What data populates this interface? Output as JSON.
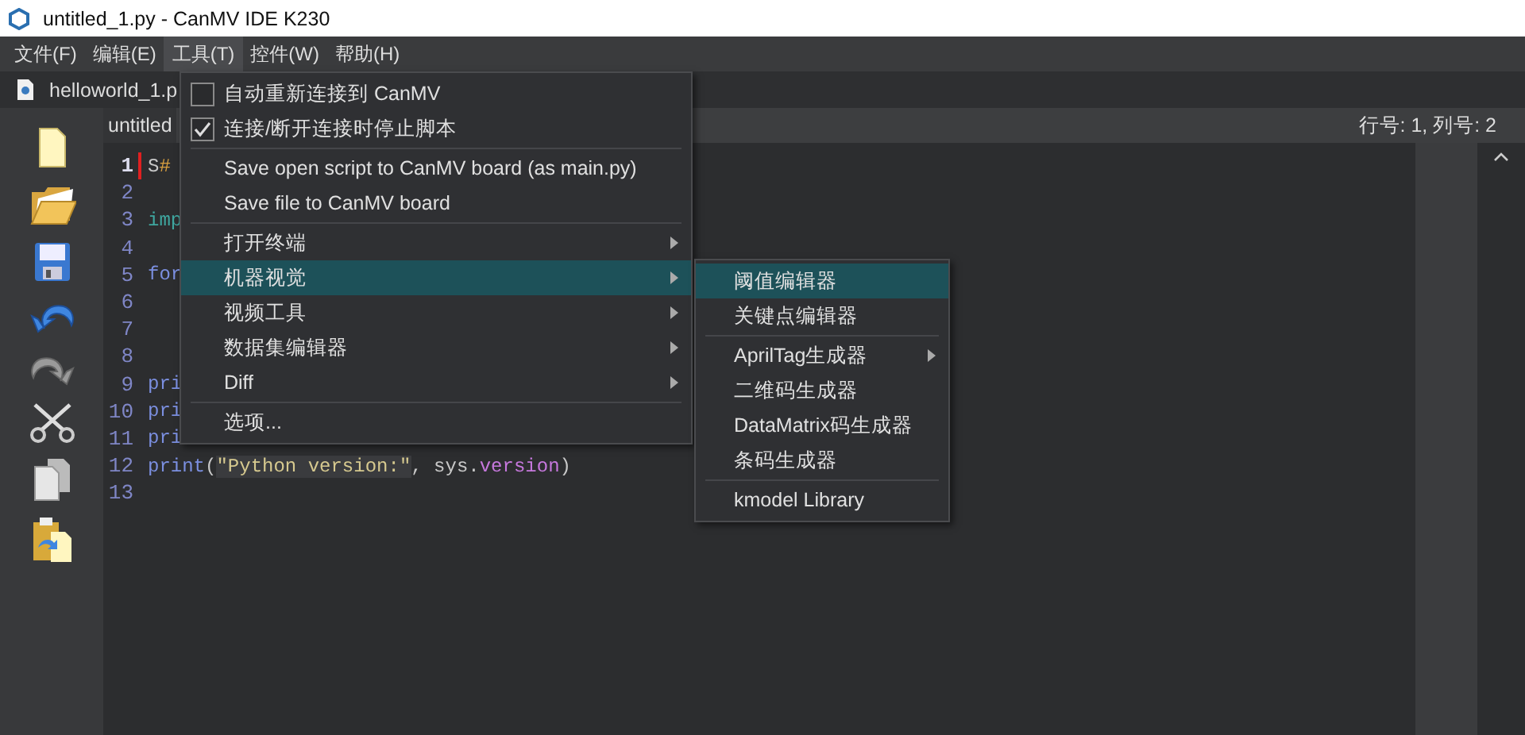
{
  "window": {
    "title": "untitled_1.py - CanMV IDE K230"
  },
  "menubar": [
    {
      "label": "文件(F)",
      "selected": false
    },
    {
      "label": "编辑(E)",
      "selected": false
    },
    {
      "label": "工具(T)",
      "selected": true
    },
    {
      "label": "控件(W)",
      "selected": false
    },
    {
      "label": "帮助(H)",
      "selected": false
    }
  ],
  "file_tabs": [
    {
      "label": "helloworld_1.p"
    }
  ],
  "toolbar": [
    {
      "kind": "new"
    },
    {
      "kind": "open"
    },
    {
      "kind": "save"
    },
    {
      "kind": "undo"
    },
    {
      "kind": "redo"
    },
    {
      "kind": "cut"
    },
    {
      "kind": "copy"
    },
    {
      "kind": "paste"
    }
  ],
  "editor": {
    "tab": "untitled",
    "status": "行号: 1, 列号: 2",
    "lines": [
      {
        "number": "1",
        "current": true,
        "tokens": [
          {
            "kind": "text",
            "text": "S"
          },
          {
            "kind": "comment",
            "text": "#"
          }
        ]
      },
      {
        "number": "2",
        "current": false
      },
      {
        "number": "3",
        "current": false,
        "tokens": [
          {
            "kind": "module",
            "text": "imp"
          }
        ]
      },
      {
        "number": "4",
        "current": false
      },
      {
        "number": "5",
        "current": false,
        "tokens": [
          {
            "kind": "keyword",
            "text": "for"
          }
        ]
      },
      {
        "number": "6",
        "current": false
      },
      {
        "number": "7",
        "current": false
      },
      {
        "number": "8",
        "current": false
      },
      {
        "number": "9",
        "current": false,
        "tokens": [
          {
            "kind": "keyword",
            "text": "pri"
          }
        ]
      },
      {
        "number": "10",
        "current": false,
        "tokens": [
          {
            "kind": "keyword",
            "text": "pri"
          }
        ]
      },
      {
        "number": "11",
        "current": false,
        "tokens": [
          {
            "kind": "keyword",
            "text": "pri"
          }
        ]
      },
      {
        "number": "12",
        "current": false,
        "tokens": [
          {
            "kind": "keyword",
            "text": "print"
          },
          {
            "kind": "text",
            "text": "("
          },
          {
            "kind": "string",
            "text": "\"Python version:\""
          },
          {
            "kind": "text",
            "text": ", sys."
          },
          {
            "kind": "attr",
            "text": "version"
          },
          {
            "kind": "text",
            "text": ")"
          }
        ]
      },
      {
        "number": "13",
        "current": false
      }
    ]
  },
  "tools_menu": {
    "groups": [
      [
        {
          "kind": "check",
          "label": "自动重新连接到 CanMV",
          "checked": false,
          "selected": false
        },
        {
          "kind": "check",
          "label": "连接/断开连接时停止脚本",
          "checked": true,
          "selected": false
        }
      ],
      [
        {
          "kind": "action",
          "label": "Save open script to CanMV board (as main.py)",
          "selected": false
        },
        {
          "kind": "action",
          "label": "Save file to CanMV board",
          "selected": false
        }
      ],
      [
        {
          "kind": "submenu",
          "label": "打开终端",
          "selected": false
        },
        {
          "kind": "submenu",
          "label": "机器视觉",
          "selected": true
        },
        {
          "kind": "submenu",
          "label": "视频工具",
          "selected": false
        },
        {
          "kind": "submenu",
          "label": "数据集编辑器",
          "selected": false
        },
        {
          "kind": "submenu",
          "label": "Diff",
          "selected": false
        }
      ],
      [
        {
          "kind": "action",
          "label": "选项...",
          "selected": false
        }
      ]
    ]
  },
  "vision_submenu": {
    "groups": [
      [
        {
          "kind": "action",
          "label": "阈值编辑器",
          "selected": true
        },
        {
          "kind": "action",
          "label": "关键点编辑器",
          "selected": false
        }
      ],
      [
        {
          "kind": "submenu",
          "label": "AprilTag生成器",
          "selected": false
        },
        {
          "kind": "action",
          "label": "二维码生成器",
          "selected": false
        },
        {
          "kind": "action",
          "label": "DataMatrix码生成器",
          "selected": false
        },
        {
          "kind": "action",
          "label": "条码生成器",
          "selected": false
        }
      ],
      [
        {
          "kind": "action",
          "label": "kmodel Library",
          "selected": false
        }
      ]
    ]
  }
}
